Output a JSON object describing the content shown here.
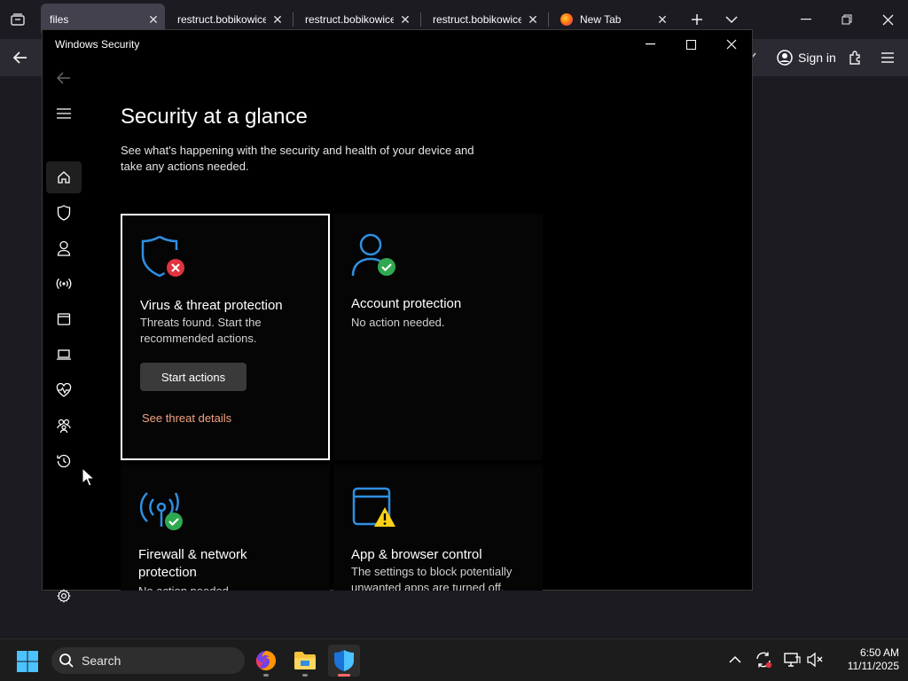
{
  "browser": {
    "tabs": [
      {
        "label": "files",
        "active": true
      },
      {
        "label": "restruct.bobikowice.",
        "active": false
      },
      {
        "label": "restruct.bobikowice.",
        "active": false
      },
      {
        "label": "restruct.bobikowice.",
        "active": false
      },
      {
        "label": "New Tab",
        "active": false
      }
    ],
    "signin_label": "Sign in"
  },
  "ws": {
    "title": "Windows Security",
    "heading": "Security at a glance",
    "subtitle": "See what's happening with the security and health of your device and take any actions needed.",
    "cards": [
      {
        "title": "Virus & threat protection",
        "desc": "Threats found. Start the recommended actions.",
        "button": "Start actions",
        "link": "See threat details",
        "status": "error"
      },
      {
        "title": "Account protection",
        "desc": "No action needed.",
        "status": "ok"
      },
      {
        "title": "Firewall & network protection",
        "desc": "No action needed.",
        "status": "ok"
      },
      {
        "title": "App & browser control",
        "desc": "The settings to block potentially unwanted apps are turned off.",
        "status": "warning"
      }
    ],
    "rail": [
      "back-icon",
      "hamburger-icon",
      "home-icon",
      "shield-icon",
      "account-icon",
      "wifi-signal-icon",
      "app-browser-icon",
      "device-laptop-icon",
      "heart-pulse-icon",
      "family-icon",
      "history-icon",
      "settings-icon"
    ]
  },
  "taskbar": {
    "search_placeholder": "Search",
    "time": "6:50 AM",
    "date": "11/11/2025"
  },
  "colors": {
    "accent_blue": "#2f8fe0",
    "error_red": "#e0343e",
    "ok_green": "#2fa84f",
    "warn_yellow": "#fcd116",
    "link_orange": "#f1a181"
  }
}
